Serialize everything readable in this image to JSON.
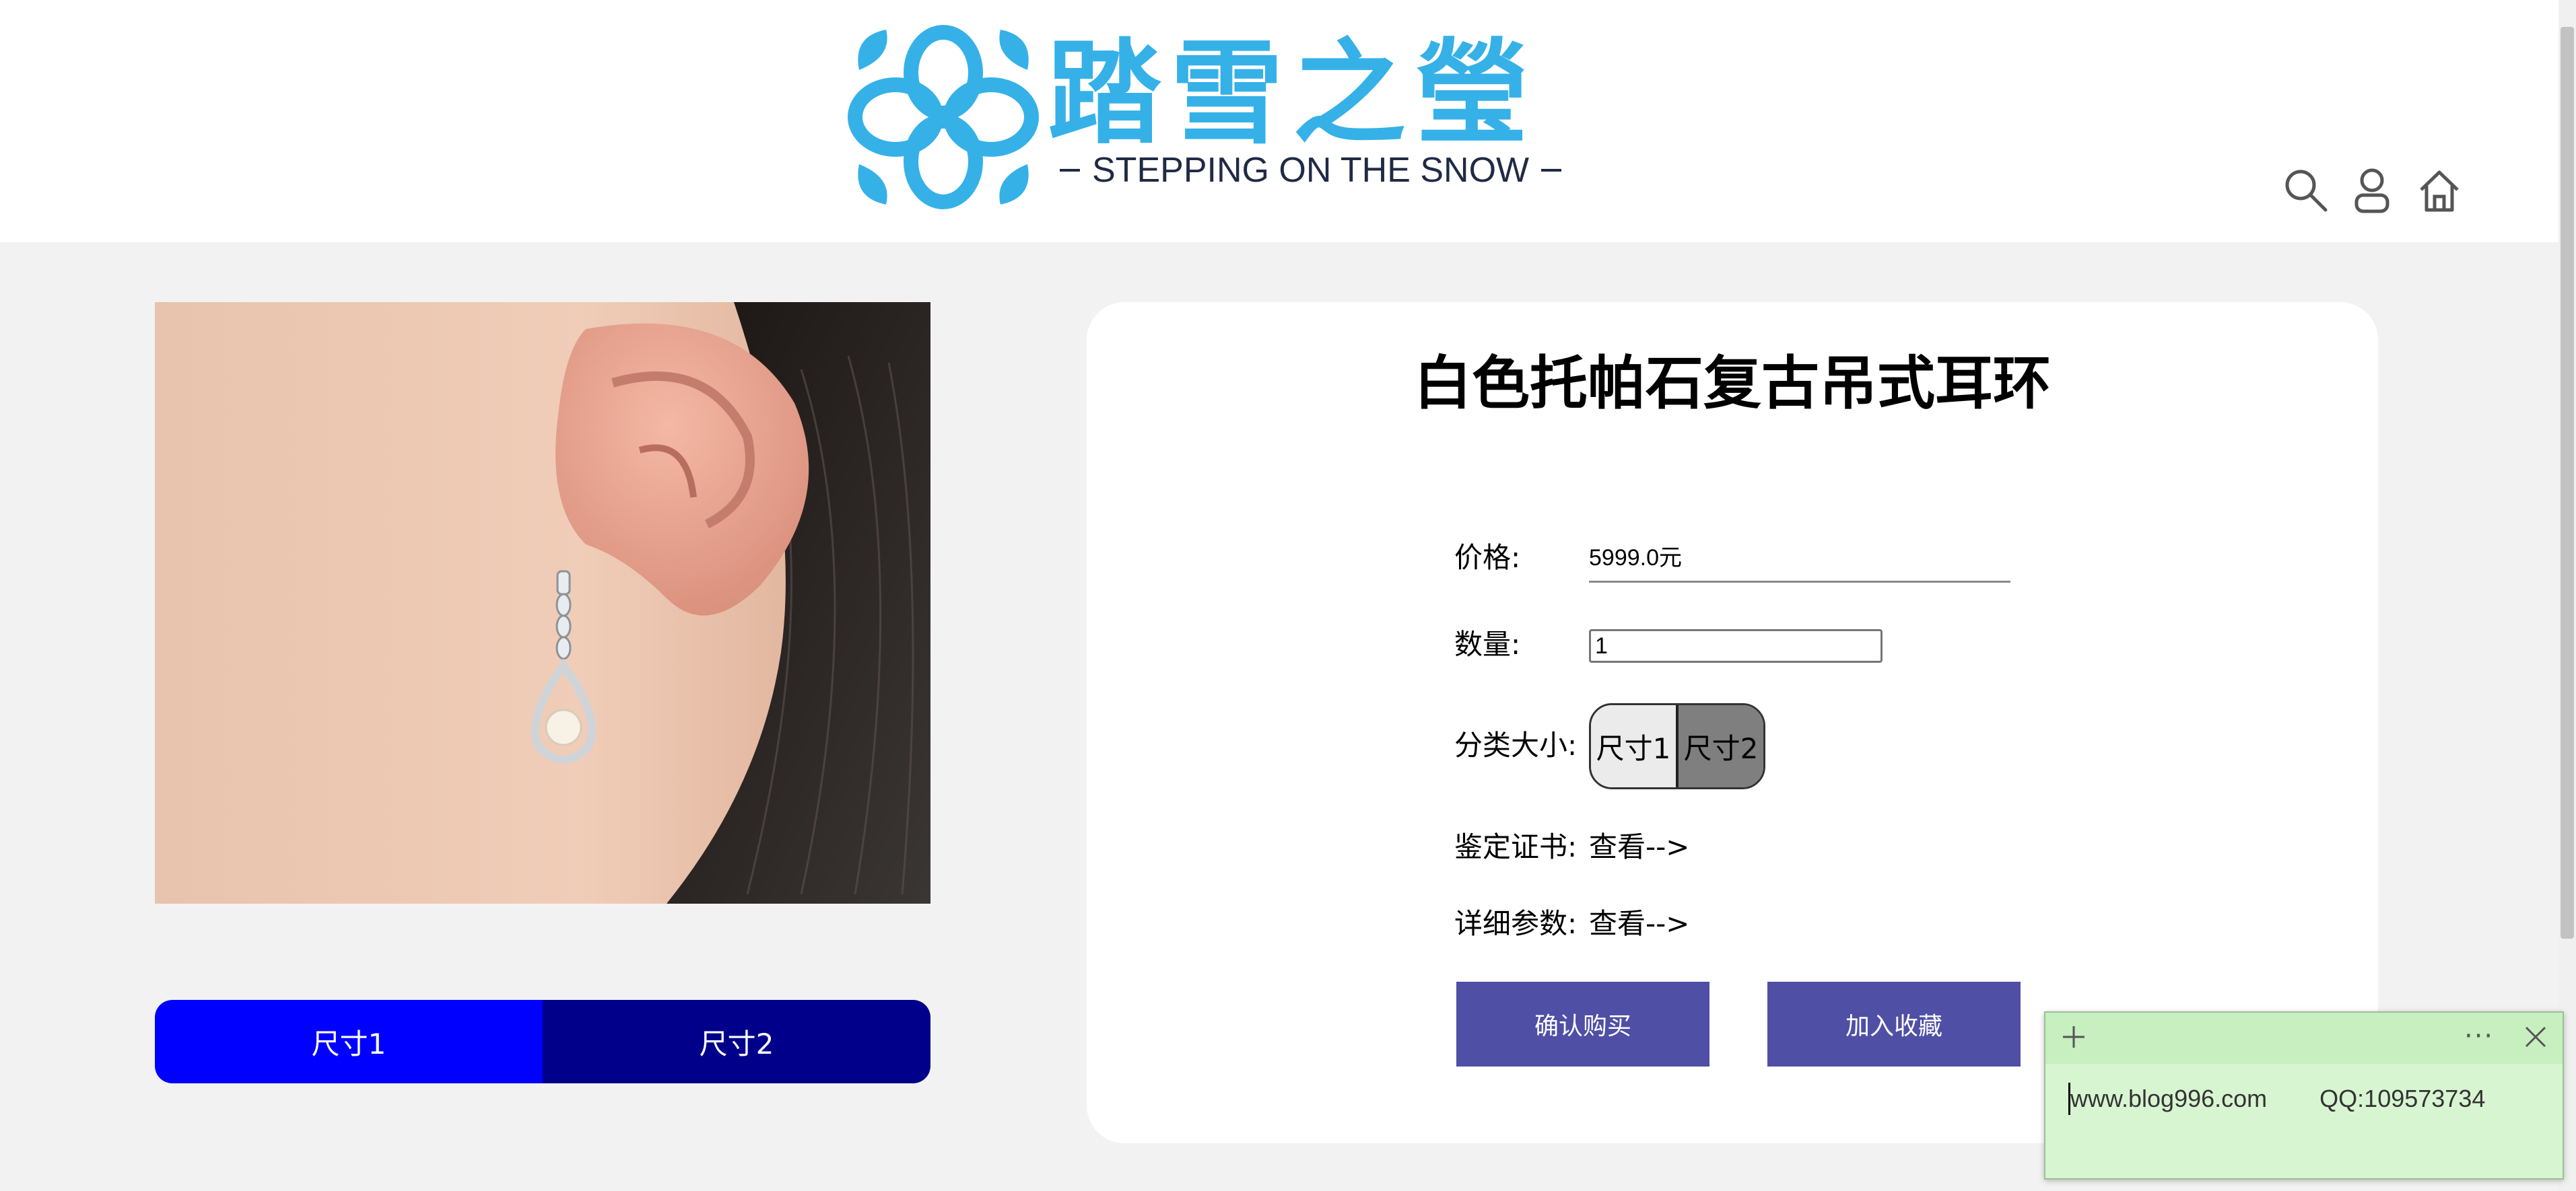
{
  "header": {
    "logo_cn": "踏雪之瑩",
    "logo_en": "STEPPING ON THE SNOW",
    "icons": [
      "search-icon",
      "user-icon",
      "home-icon"
    ]
  },
  "colors": {
    "logo": "#35b1e8",
    "tab_active": "#0000ff",
    "tab_inactive": "#00008a",
    "action_button": "#4f4fa6"
  },
  "gallery": {
    "tabs": [
      "尺寸1",
      "尺寸2"
    ],
    "active_tab": 0
  },
  "product": {
    "title": "白色托帕石复古吊式耳环",
    "price_label": "价格:",
    "price_value": "5999.0元",
    "quantity_label": "数量:",
    "quantity_value": "1",
    "category_label": "分类大小:",
    "variants": [
      "尺寸1",
      "尺寸2"
    ],
    "selected_variant": 1,
    "certificate_label": "鉴定证书:",
    "certificate_link": "查看-->",
    "params_label": "详细参数:",
    "params_link": "查看-->",
    "buy_button": "确认购买",
    "favorite_button": "加入收藏"
  },
  "sticky_note": {
    "website": "www.blog996.com",
    "qq": "QQ:109573734",
    "more_icon": "···"
  }
}
